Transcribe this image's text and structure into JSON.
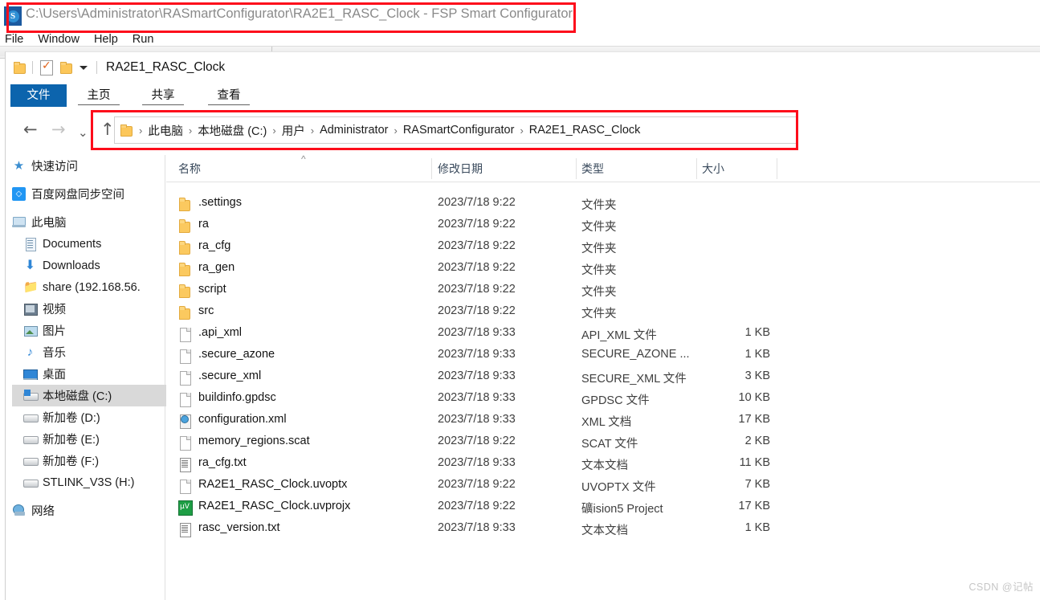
{
  "app": {
    "icon": "fsp-app-icon",
    "icon_glyph": "S",
    "title": "C:\\Users\\Administrator\\RASmartConfigurator\\RA2E1_RASC_Clock - FSP Smart Configurator",
    "menu": [
      {
        "label": "File"
      },
      {
        "label": "Window"
      },
      {
        "label": "Help"
      },
      {
        "label": "Run"
      }
    ]
  },
  "explorer": {
    "quick_access": {
      "folder_icon": "folder-icon",
      "properties_icon": "properties-checklist-icon",
      "new_folder_icon": "new-folder-icon",
      "customize_icon": "chevron-down-icon",
      "window_title": "RA2E1_RASC_Clock"
    },
    "ribbon_tabs": [
      {
        "label": "文件",
        "active": true
      },
      {
        "label": "主页",
        "active": false
      },
      {
        "label": "共享",
        "active": false
      },
      {
        "label": "查看",
        "active": false
      }
    ],
    "navigation": {
      "back_icon": "arrow-left-icon",
      "forward_icon": "arrow-right-icon",
      "recent_icon": "chevron-down-icon",
      "up_icon": "arrow-up-icon",
      "address_folder_icon": "folder-icon",
      "breadcrumbs": [
        "此电脑",
        "本地磁盘 (C:)",
        "用户",
        "Administrator",
        "RASmartConfigurator",
        "RA2E1_RASC_Clock"
      ],
      "separator": "›"
    },
    "sidebar": [
      {
        "label": "快速访问",
        "icon": "quick-access-star-icon",
        "indent": 0,
        "selected": false
      },
      {
        "label": "百度网盘同步空间",
        "icon": "baidu-netdisk-icon",
        "indent": 0,
        "selected": false
      },
      {
        "label": "此电脑",
        "icon": "this-pc-icon",
        "indent": 0,
        "selected": false
      },
      {
        "label": "Documents",
        "icon": "documents-icon",
        "indent": 1,
        "selected": false
      },
      {
        "label": "Downloads",
        "icon": "downloads-icon",
        "indent": 1,
        "selected": false
      },
      {
        "label": "share (192.168.56.",
        "icon": "network-share-icon",
        "indent": 1,
        "selected": false
      },
      {
        "label": "视频",
        "icon": "videos-icon",
        "indent": 1,
        "selected": false
      },
      {
        "label": "图片",
        "icon": "pictures-icon",
        "indent": 1,
        "selected": false
      },
      {
        "label": "音乐",
        "icon": "music-icon",
        "indent": 1,
        "selected": false
      },
      {
        "label": "桌面",
        "icon": "desktop-icon",
        "indent": 1,
        "selected": false
      },
      {
        "label": "本地磁盘 (C:)",
        "icon": "local-disk-c-icon",
        "indent": 1,
        "selected": true
      },
      {
        "label": "新加卷 (D:)",
        "icon": "drive-icon",
        "indent": 1,
        "selected": false
      },
      {
        "label": "新加卷 (E:)",
        "icon": "drive-icon",
        "indent": 1,
        "selected": false
      },
      {
        "label": "新加卷 (F:)",
        "icon": "drive-icon",
        "indent": 1,
        "selected": false
      },
      {
        "label": "STLINK_V3S (H:)",
        "icon": "drive-icon",
        "indent": 1,
        "selected": false
      },
      {
        "label": "网络",
        "icon": "network-icon",
        "indent": 0,
        "selected": false
      }
    ],
    "columns": [
      {
        "key": "name",
        "label": "名称",
        "sorted": true
      },
      {
        "key": "date",
        "label": "修改日期",
        "sorted": false
      },
      {
        "key": "type",
        "label": "类型",
        "sorted": false
      },
      {
        "key": "size",
        "label": "大小",
        "sorted": false
      }
    ],
    "sort_indicator": "^",
    "files": [
      {
        "name": ".settings",
        "date": "2023/7/18 9:22",
        "type": "文件夹",
        "size": "",
        "icon": "folder-icon"
      },
      {
        "name": "ra",
        "date": "2023/7/18 9:22",
        "type": "文件夹",
        "size": "",
        "icon": "folder-icon"
      },
      {
        "name": "ra_cfg",
        "date": "2023/7/18 9:22",
        "type": "文件夹",
        "size": "",
        "icon": "folder-icon"
      },
      {
        "name": "ra_gen",
        "date": "2023/7/18 9:22",
        "type": "文件夹",
        "size": "",
        "icon": "folder-icon"
      },
      {
        "name": "script",
        "date": "2023/7/18 9:22",
        "type": "文件夹",
        "size": "",
        "icon": "folder-icon"
      },
      {
        "name": "src",
        "date": "2023/7/18 9:22",
        "type": "文件夹",
        "size": "",
        "icon": "folder-icon"
      },
      {
        "name": ".api_xml",
        "date": "2023/7/18 9:33",
        "type": "API_XML 文件",
        "size": "1 KB",
        "icon": "blank-file-icon"
      },
      {
        "name": ".secure_azone",
        "date": "2023/7/18 9:33",
        "type": "SECURE_AZONE ...",
        "size": "1 KB",
        "icon": "blank-file-icon"
      },
      {
        "name": ".secure_xml",
        "date": "2023/7/18 9:33",
        "type": "SECURE_XML 文件",
        "size": "3 KB",
        "icon": "blank-file-icon"
      },
      {
        "name": "buildinfo.gpdsc",
        "date": "2023/7/18 9:33",
        "type": "GPDSC 文件",
        "size": "10 KB",
        "icon": "blank-file-icon"
      },
      {
        "name": "configuration.xml",
        "date": "2023/7/18 9:33",
        "type": "XML 文档",
        "size": "17 KB",
        "icon": "xml-document-icon"
      },
      {
        "name": "memory_regions.scat",
        "date": "2023/7/18 9:22",
        "type": "SCAT 文件",
        "size": "2 KB",
        "icon": "blank-file-icon"
      },
      {
        "name": "ra_cfg.txt",
        "date": "2023/7/18 9:33",
        "type": "文本文档",
        "size": "11 KB",
        "icon": "text-file-icon"
      },
      {
        "name": "RA2E1_RASC_Clock.uvoptx",
        "date": "2023/7/18 9:22",
        "type": "UVOPTX 文件",
        "size": "7 KB",
        "icon": "blank-file-icon"
      },
      {
        "name": "RA2E1_RASC_Clock.uvprojx",
        "date": "2023/7/18 9:22",
        "type": "礦ision5 Project",
        "size": "17 KB",
        "icon": "uvision-project-icon"
      },
      {
        "name": "rasc_version.txt",
        "date": "2023/7/18 9:33",
        "type": "文本文档",
        "size": "1 KB",
        "icon": "text-file-icon"
      }
    ]
  },
  "annotations": {
    "color": "#fd0d1b",
    "boxes": [
      {
        "target": "title-bar"
      },
      {
        "target": "address-bar"
      }
    ]
  },
  "watermark": {
    "text": "CSDN @记帖"
  }
}
